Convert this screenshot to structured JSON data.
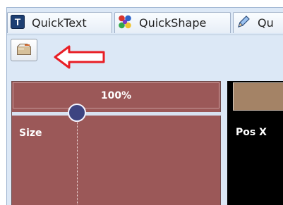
{
  "tabs": [
    {
      "label": "QuickText",
      "icon": "quicktext-icon"
    },
    {
      "label": "QuickShape",
      "icon": "quickshape-icon"
    },
    {
      "label": "Qu",
      "icon": "pen-icon"
    }
  ],
  "toolbar": {
    "button_icon": "box-icon",
    "arrow_color": "#e81e25"
  },
  "size_panel": {
    "percent": "100%",
    "label": "Size",
    "slider_level": 0.3,
    "color": "#9b5858"
  },
  "right_panel": {
    "label": "Pos X",
    "color": "#000000"
  }
}
